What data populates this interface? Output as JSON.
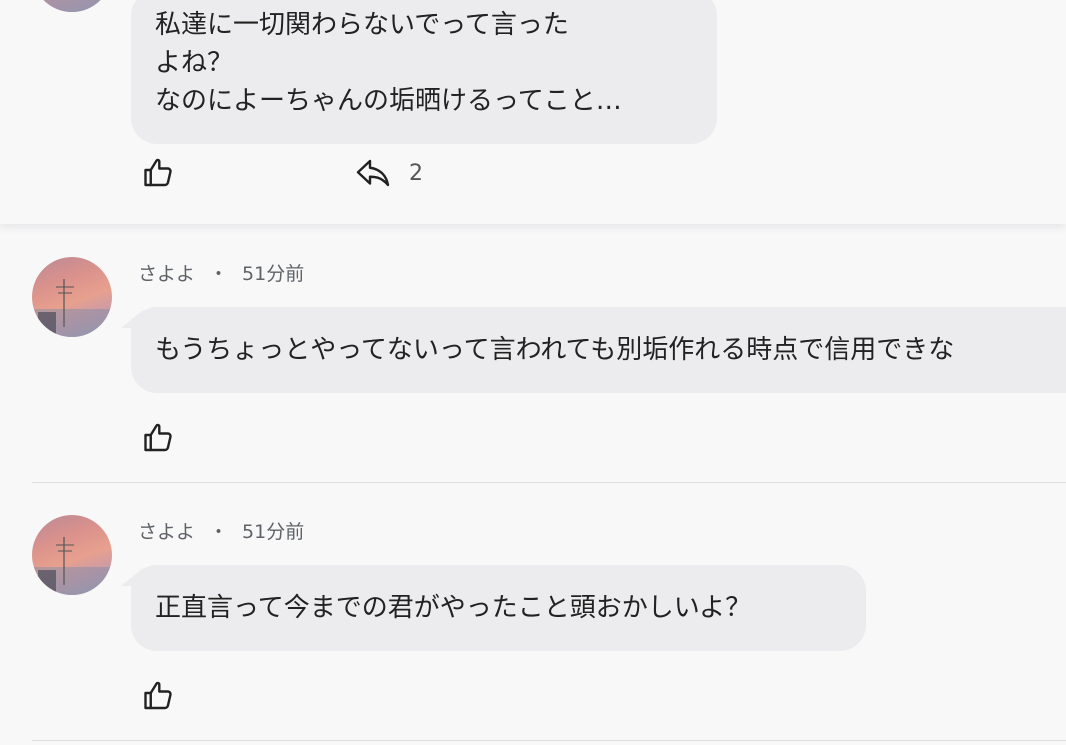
{
  "thread": {
    "top_comment": {
      "lines": [
        "私達に一切関わらないでって言った",
        "よね？",
        "なのによーちゃんの垢晒けるってこと…"
      ],
      "reply_count": "2"
    },
    "replies": [
      {
        "author": "さよよ",
        "separator": "・",
        "time": "51分前",
        "text": "もうちょっとやってないって言われても別垢作れる時点で信用できな"
      },
      {
        "author": "さよよ",
        "separator": "・",
        "time": "51分前",
        "text": "正直言って今までの君がやったこと頭おかしいよ？"
      }
    ]
  },
  "icons": {
    "like": "thumbs-up-icon",
    "reply": "reply-icon"
  },
  "colors": {
    "background": "#f8f8f9",
    "bubble": "#ececee",
    "divider": "#dedee0",
    "meta_text": "#5f6368"
  }
}
